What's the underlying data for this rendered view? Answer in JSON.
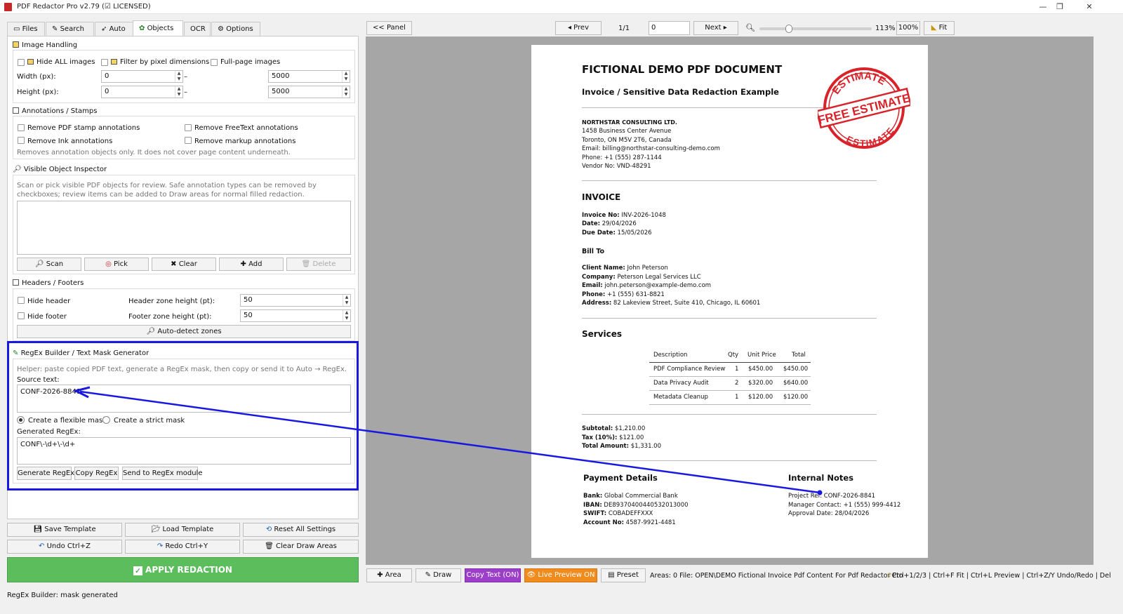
{
  "window": {
    "title": "PDF Redactor Pro v2.79 (☑ LICENSED)",
    "controls": [
      "—",
      "❐",
      "✕"
    ]
  },
  "tabs": [
    {
      "label": "Files",
      "icon": "folder-icon"
    },
    {
      "label": "Search",
      "icon": "pencil-icon"
    },
    {
      "label": "Auto",
      "icon": "rocket-icon"
    },
    {
      "label": "Objects",
      "icon": "gear-icon",
      "active": true
    },
    {
      "label": "OCR"
    },
    {
      "label": "Options",
      "icon": "gear-icon"
    }
  ],
  "image_handling": {
    "title": "Image Handling",
    "hide_all": "Hide ALL images",
    "filter_pixels": "Filter by pixel dimensions",
    "full_page": "Full-page images",
    "width_label": "Width (px):",
    "height_label": "Height (px):",
    "width_min": "0",
    "width_max": "5000",
    "height_min": "0",
    "height_max": "5000",
    "dash": "–"
  },
  "annotations": {
    "title": "Annotations / Stamps",
    "stamp": "Remove PDF stamp annotations",
    "freetext": "Remove FreeText annotations",
    "ink": "Remove Ink annotations",
    "markup": "Remove markup annotations",
    "note": "Removes annotation objects only. It does not cover page content underneath."
  },
  "inspector": {
    "title": "Visible Object Inspector",
    "help": "Scan or pick visible PDF objects for review. Safe annotation types can be removed by checkboxes; review items can be added to Draw areas for normal filled redaction.",
    "buttons": [
      "Scan",
      "Pick",
      "Clear",
      "Add",
      "Delete"
    ]
  },
  "headers_footers": {
    "title": "Headers / Footers",
    "hide_header": "Hide header",
    "hide_footer": "Hide footer",
    "header_zone": "Header zone height (pt):",
    "footer_zone": "Footer zone height (pt):",
    "header_value": "50",
    "footer_value": "50",
    "autodetect": "Auto-detect zones"
  },
  "regex": {
    "title": "RegEx Builder / Text Mask Generator",
    "helper": "Helper: paste copied PDF text, generate a RegEx mask, then copy or send it to Auto → RegEx.",
    "source_label": "Source text:",
    "source_value": "CONF-2026-8841",
    "flexible": "Create a flexible mask",
    "strict": "Create a strict mask",
    "generated_label": "Generated RegEx:",
    "generated_value": "CONF\\-\\d+\\-\\d+",
    "generate": "Generate RegEx",
    "copy": "Copy RegEx",
    "send": "Send to RegEx module"
  },
  "bottom_buttons": {
    "save_template": "Save Template",
    "load_template": "Load Template",
    "reset": "Reset All Settings",
    "undo": "Undo  Ctrl+Z",
    "redo": "Redo  Ctrl+Y",
    "clear_draw": "Clear Draw Areas",
    "apply": "APPLY REDACTION"
  },
  "status_text": "RegEx Builder: mask generated",
  "toolbar": {
    "panel": "<< Panel",
    "prev": "◂ Prev",
    "page_of": "1/1",
    "page_input": "0",
    "next": "Next ▸",
    "zoom_value": 0.113,
    "zoom_label": "113%",
    "hundred": "100%",
    "fit": "Fit"
  },
  "bottom_toolbar": {
    "area": "Area",
    "draw": "Draw",
    "copy_text": "Copy Text (ON)",
    "live_preview": "Live Preview ON",
    "preset": "Preset",
    "info": "Areas: 0  File: OPEN\\DEMO Fictional Invoice Pdf Content For Pdf Redactor Pro",
    "shortcuts": "Ctrl+1/2/3 | Ctrl+F Fit | Ctrl+L Preview | Ctrl+Z/Y Undo/Redo | Del"
  },
  "document": {
    "title": "FICTIONAL DEMO PDF DOCUMENT",
    "subtitle": "Invoice / Sensitive Data Redaction Example",
    "stamp_top": "ESTIMATE",
    "stamp_mid": "FREE ESTIMATE",
    "stamp_bottom": "ESTIMATE",
    "vendor": {
      "name": "NORTHSTAR CONSULTING LTD.",
      "address": "1458 Business Center Avenue",
      "city": "Toronto, ON M5V 2T6, Canada",
      "email": "Email: billing@northstar-consulting-demo.com",
      "phone": "Phone: +1 (555) 287-1144",
      "vendor_no": "Vendor No: VND-48291"
    },
    "invoice_heading": "INVOICE",
    "invoice_no_label": "Invoice No:",
    "invoice_no": " INV-2026-1048",
    "date_label": "Date:",
    "date": " 29/04/2026",
    "due_label": "Due Date:",
    "due": " 15/05/2026",
    "bill_to": "Bill To",
    "client_label": "Client Name:",
    "client": " John Peterson",
    "company_label": "Company:",
    "company": " Peterson Legal Services LLC",
    "email_label": "Email:",
    "email": " john.peterson@example-demo.com",
    "phone_label": "Phone:",
    "phone": " +1 (555) 631-8821",
    "address_label": "Address:",
    "address": " 82 Lakeview Street, Suite 410, Chicago, IL 60601",
    "services_heading": "Services",
    "table_headers": [
      "Description",
      "Qty",
      "Unit Price",
      "Total"
    ],
    "table_rows": [
      [
        "PDF Compliance Review",
        "1",
        "$450.00",
        "$450.00"
      ],
      [
        "Data Privacy Audit",
        "2",
        "$320.00",
        "$640.00"
      ],
      [
        "Metadata Cleanup",
        "1",
        "$120.00",
        "$120.00"
      ]
    ],
    "subtotal_label": "Subtotal:",
    "subtotal": " $1,210.00",
    "tax_label": "Tax (10%):",
    "tax": " $121.00",
    "total_label": "Total Amount:",
    "total": " $1,331.00",
    "payment_heading": "Payment Details",
    "bank_label": "Bank:",
    "bank": " Global Commercial Bank",
    "iban_label": "IBAN:",
    "iban": " DE89370400440532013000",
    "swift_label": "SWIFT:",
    "swift": " COBADEFFXXX",
    "account_label": "Account No:",
    "account": " 4587-9921-4481",
    "notes_heading": "Internal Notes",
    "project_ref": "Project Ref: CONF-2026-8841",
    "manager": "Manager Contact: +1 (555) 999-4412",
    "approval": "Approval Date: 28/04/2026"
  },
  "colors": {
    "annotation_blue": "#1818e0",
    "apply_green": "#5cbd5c",
    "copy_purple": "#9c3ec8",
    "preview_orange": "#f08c1e",
    "stamp_red": "#d8232a"
  }
}
